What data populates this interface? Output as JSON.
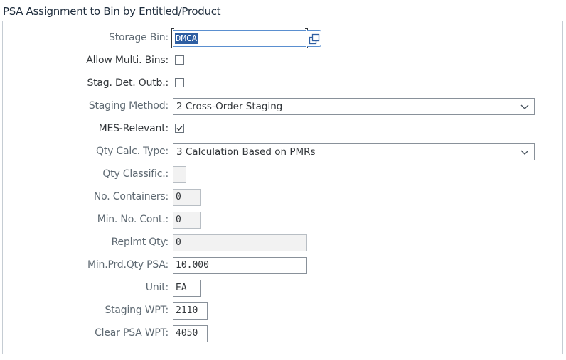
{
  "group": {
    "title": "PSA Assignment to Bin by Entitled/Product"
  },
  "fields": {
    "storage_bin": {
      "label": "Storage Bin:",
      "value": "DMCA",
      "value_help_icon": "value-help-icon"
    },
    "allow_multi_bins": {
      "label": "Allow Multi. Bins:",
      "checked": false
    },
    "stag_det_outb": {
      "label": "Stag. Det. Outb.:",
      "checked": false
    },
    "staging_method": {
      "label": "Staging Method:",
      "value": "2 Cross-Order Staging"
    },
    "mes_relevant": {
      "label": "MES-Relevant:",
      "checked": true
    },
    "qty_calc_type": {
      "label": "Qty Calc. Type:",
      "value": "3 Calculation Based on PMRs"
    },
    "qty_classific": {
      "label": "Qty Classific.:",
      "value": ""
    },
    "no_containers": {
      "label": "No. Containers:",
      "value": "0"
    },
    "min_no_cont": {
      "label": "Min. No. Cont.:",
      "value": "0"
    },
    "replmt_qty": {
      "label": "Replmt Qty:",
      "value": "0"
    },
    "min_prd_qty_psa": {
      "label": "Min.Prd.Qty PSA:",
      "value": "10.000"
    },
    "unit": {
      "label": "Unit:",
      "value": "EA"
    },
    "staging_wpt": {
      "label": "Staging WPT:",
      "value": "2110"
    },
    "clear_psa_wpt": {
      "label": "Clear PSA WPT:",
      "value": "4050"
    }
  },
  "colors": {
    "selection": "#2e5ea2",
    "focus_border": "#5a8fd0",
    "readonly_bg": "#f2f2f2"
  }
}
